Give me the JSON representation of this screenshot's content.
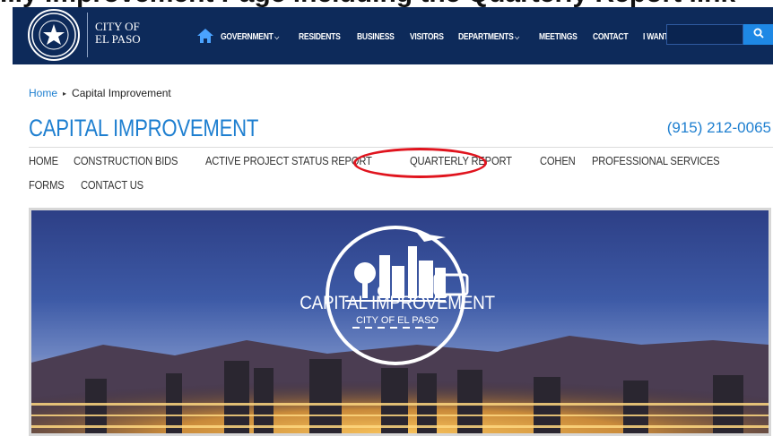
{
  "caption": {
    "text": "...y Improvement Page including the Quarterly Report link"
  },
  "header": {
    "logo_line1": "CITY OF",
    "logo_line2": "EL PASO",
    "seal_icon": "city-seal-icon",
    "home_icon": "home-icon",
    "nav": [
      {
        "label": "GOVERNMENT",
        "dropdown": true
      },
      {
        "label": "RESIDENTS",
        "dropdown": false
      },
      {
        "label": "BUSINESS",
        "dropdown": false
      },
      {
        "label": "VISITORS",
        "dropdown": false
      },
      {
        "label": "DEPARTMENTS",
        "dropdown": true
      },
      {
        "label": "MEETINGS",
        "dropdown": false
      },
      {
        "label": "CONTACT",
        "dropdown": false
      },
      {
        "label": "I WANT TO",
        "dropdown": true
      }
    ],
    "search_placeholder": "",
    "search_icon": "search-icon"
  },
  "breadcrumb": {
    "home": "Home",
    "current": "Capital Improvement"
  },
  "page": {
    "title": "CAPITAL IMPROVEMENT",
    "phone": "(915) 212-0065"
  },
  "subnav": [
    "HOME",
    "CONSTRUCTION BIDS",
    "ACTIVE PROJECT STATUS REPORT",
    "QUARTERLY REPORT",
    "COHEN",
    "PROFESSIONAL SERVICES",
    "FORMS",
    "CONTACT US"
  ],
  "hero": {
    "emblem_title": "CAPITAL IMPROVEMENT",
    "emblem_subtitle": "CITY OF EL PASO"
  },
  "colors": {
    "navbar": "#0d2a5a",
    "accent_blue": "#1e7fd0",
    "search_button": "#1e88e5",
    "highlight_ring": "#e0141e"
  }
}
